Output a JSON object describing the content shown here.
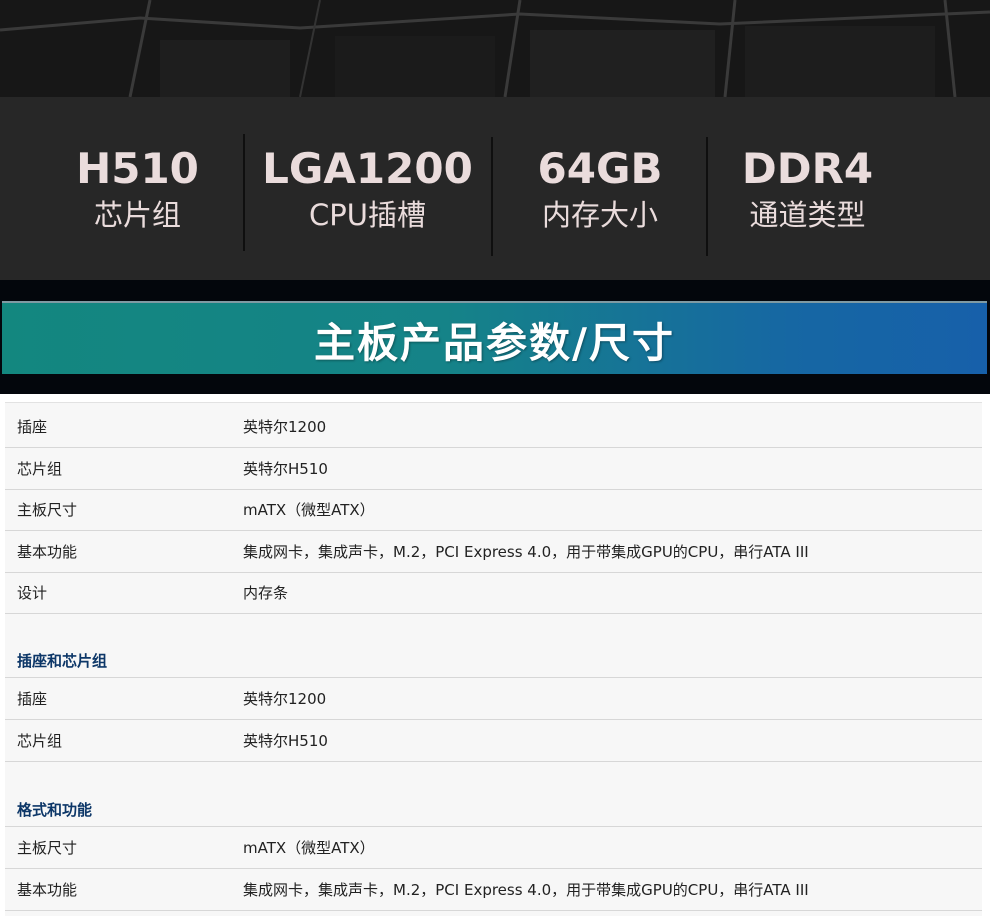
{
  "specs": [
    {
      "value": "H510",
      "label": "芯片组"
    },
    {
      "value": "LGA1200",
      "label": "CPU插槽"
    },
    {
      "value": "64GB",
      "label": "内存大小"
    },
    {
      "value": "DDR4",
      "label": "通道类型"
    }
  ],
  "banner": {
    "title": "主板产品参数/尺寸"
  },
  "table": {
    "general": [
      {
        "key": "插座",
        "value": "英特尔1200"
      },
      {
        "key": "芯片组",
        "value": "英特尔H510"
      },
      {
        "key": "主板尺寸",
        "value": "mATX（微型ATX）"
      },
      {
        "key": "基本功能",
        "value": "集成网卡，集成声卡，M.2，PCI Express 4.0，用于带集成GPU的CPU，串行ATA III"
      },
      {
        "key": "设计",
        "value": "内存条"
      }
    ],
    "section1": {
      "title": "插座和芯片组",
      "rows": [
        {
          "key": "插座",
          "value": "英特尔1200"
        },
        {
          "key": "芯片组",
          "value": "英特尔H510"
        }
      ]
    },
    "section2": {
      "title": "格式和功能",
      "rows": [
        {
          "key": "主板尺寸",
          "value": "mATX（微型ATX）"
        },
        {
          "key": "基本功能",
          "value": "集成网卡，集成声卡，M.2，PCI Express 4.0，用于带集成GPU的CPU，串行ATA III"
        }
      ]
    }
  }
}
